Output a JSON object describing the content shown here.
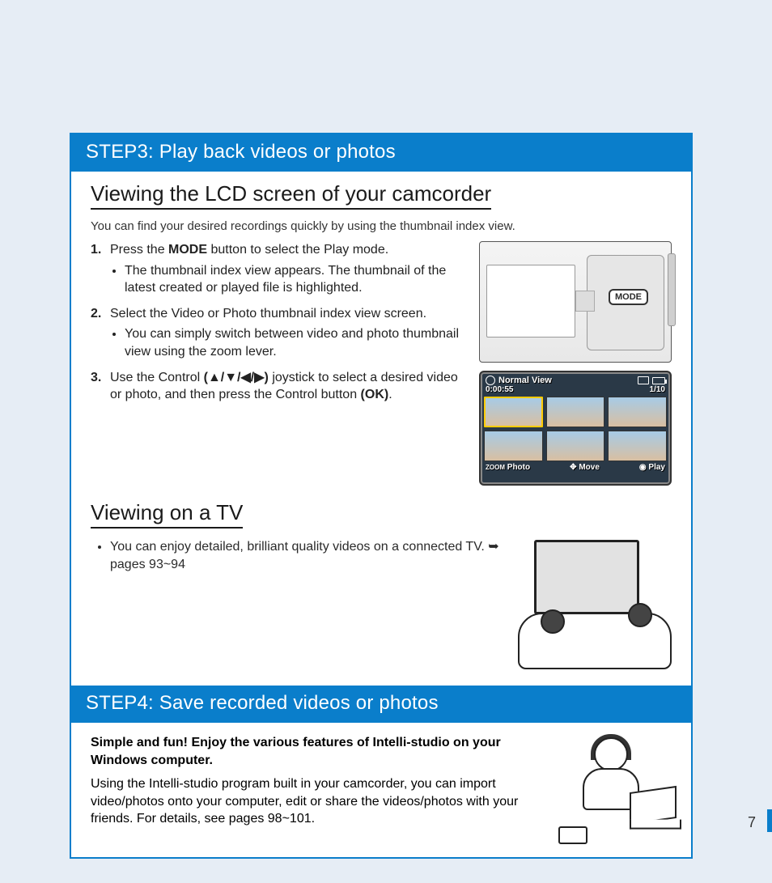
{
  "step3": {
    "header": "STEP3: Play back videos or photos",
    "section1": {
      "heading": "Viewing the LCD screen of your camcorder",
      "intro": "You can find your desired recordings quickly by using the thumbnail index view.",
      "steps": [
        {
          "prefix": "Press the ",
          "bold1": "MODE",
          "suffix": " button to select the Play mode.",
          "sub": [
            "The thumbnail index view appears. The thumbnail of the latest created or played file is highlighted."
          ]
        },
        {
          "text": "Select the Video or Photo thumbnail index view screen.",
          "sub": [
            "You can simply switch between video and photo thumbnail view using the zoom lever."
          ]
        },
        {
          "prefix": "Use the Control ",
          "bold1": "(▲/▼/◀/▶)",
          "mid": " joystick to select a desired video or photo, and then press the Control button ",
          "bold2": "(OK)",
          "suffix": "."
        }
      ],
      "modeBadge": "MODE",
      "lcd": {
        "title": "Normal View",
        "time": "0:00:55",
        "counter": "1/10",
        "bottom": {
          "zoom": "ZOOM",
          "photo": "Photo",
          "move": "Move",
          "play": "Play"
        }
      }
    },
    "section2": {
      "heading": "Viewing on a TV",
      "bullet_prefix": "You can enjoy detailed, brilliant quality videos on a connected TV. ",
      "arrow": "➥",
      "bullet_suffix": " pages 93~94"
    }
  },
  "step4": {
    "header": "STEP4: Save recorded videos or photos",
    "bold": "Simple and fun! Enjoy the various features of Intelli-studio on your Windows computer.",
    "text": "Using the Intelli-studio program built in your camcorder, you can import video/photos onto your computer, edit or share the videos/photos with your friends. For details, see pages 98~101."
  },
  "pageNumber": "7"
}
